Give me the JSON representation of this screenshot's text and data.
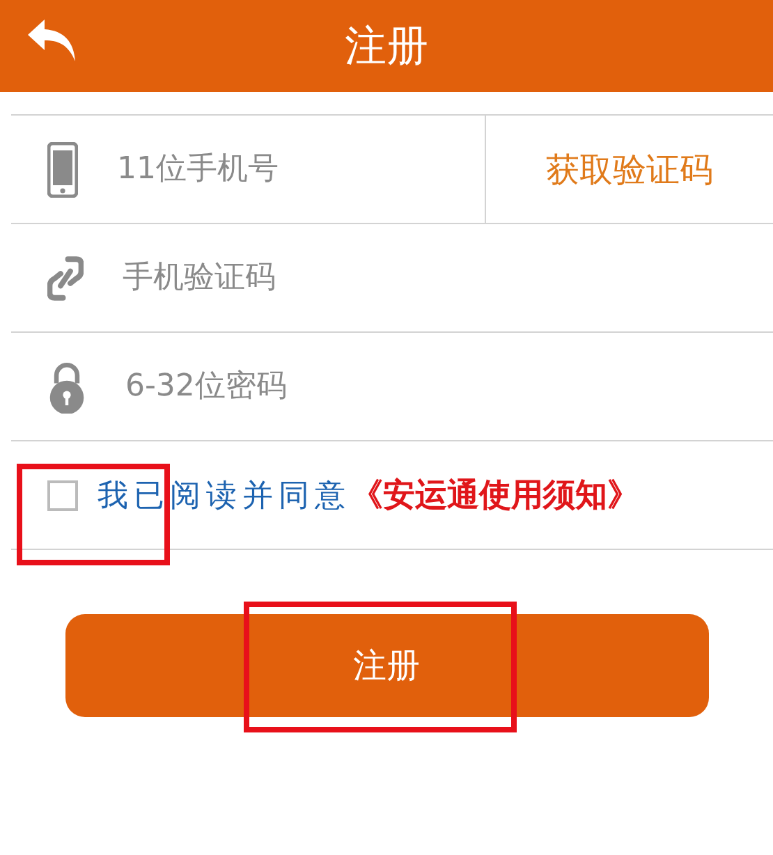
{
  "header": {
    "title": "注册"
  },
  "fields": [
    {
      "kind": "phone",
      "placeholder": "11位手机号",
      "action": "获取验证码"
    },
    {
      "kind": "code",
      "placeholder": "手机验证码"
    },
    {
      "kind": "password",
      "placeholder": "6-32位密码"
    }
  ],
  "agreement": {
    "checked": false,
    "text": "我已阅读并同意",
    "link": "《安运通使用须知》"
  },
  "submit": "注册"
}
